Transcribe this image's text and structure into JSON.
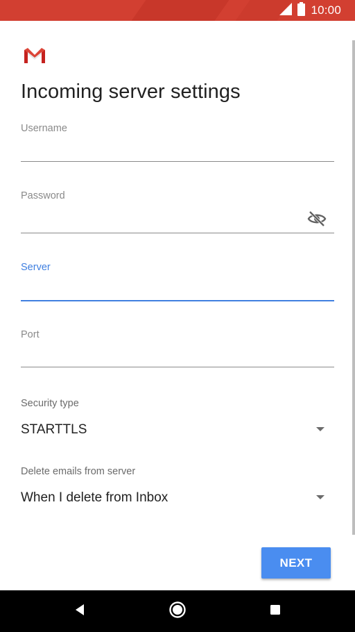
{
  "status_bar": {
    "time": "10:00",
    "color": "#d23f31",
    "icons": [
      "signal-icon",
      "battery-icon"
    ]
  },
  "app": {
    "logo": "gmail-logo-icon"
  },
  "page": {
    "title": "Incoming server settings"
  },
  "form": {
    "username": {
      "label": "Username",
      "value": ""
    },
    "password": {
      "label": "Password",
      "value": "",
      "toggle_icon": "visibility-off-icon"
    },
    "server": {
      "label": "Server",
      "value": "",
      "focused": true,
      "accent": "#3f7fe0"
    },
    "port": {
      "label": "Port",
      "value": ""
    },
    "security_type": {
      "label": "Security type",
      "value": "STARTTLS"
    },
    "delete_emails": {
      "label": "Delete emails from server",
      "value": "When I delete from Inbox"
    }
  },
  "actions": {
    "next_label": "NEXT",
    "next_color": "#4a8df0"
  },
  "nav_bar": {
    "icons": [
      "back-icon",
      "home-icon",
      "recents-icon"
    ]
  }
}
